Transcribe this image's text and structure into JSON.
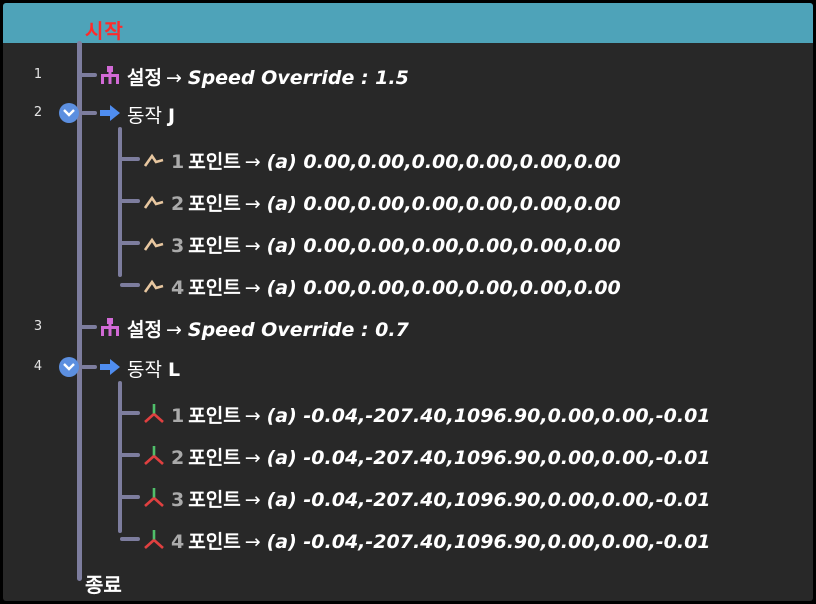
{
  "start_label": "시작",
  "end_label": "종료",
  "rows": [
    {
      "num": "1",
      "title": "설정",
      "detail": "Speed Override : 1.5"
    },
    {
      "num": "2",
      "title": "동작",
      "mode": "J"
    },
    {
      "point_num": "1",
      "point_label": "포인트",
      "value": "(a) 0.00,0.00,0.00,0.00,0.00,0.00"
    },
    {
      "point_num": "2",
      "point_label": "포인트",
      "value": "(a) 0.00,0.00,0.00,0.00,0.00,0.00"
    },
    {
      "point_num": "3",
      "point_label": "포인트",
      "value": "(a) 0.00,0.00,0.00,0.00,0.00,0.00"
    },
    {
      "point_num": "4",
      "point_label": "포인트",
      "value": "(a) 0.00,0.00,0.00,0.00,0.00,0.00"
    },
    {
      "num": "3",
      "title": "설정",
      "detail": "Speed Override : 0.7"
    },
    {
      "num": "4",
      "title": "동작",
      "mode": "L"
    },
    {
      "point_num": "1",
      "point_label": "포인트",
      "value": "(a) -0.04,-207.40,1096.90,0.00,0.00,-0.01"
    },
    {
      "point_num": "2",
      "point_label": "포인트",
      "value": "(a) -0.04,-207.40,1096.90,0.00,0.00,-0.01"
    },
    {
      "point_num": "3",
      "point_label": "포인트",
      "value": "(a) -0.04,-207.40,1096.90,0.00,0.00,-0.01"
    },
    {
      "point_num": "4",
      "point_label": "포인트",
      "value": "(a) -0.04,-207.40,1096.90,0.00,0.00,-0.01"
    }
  ],
  "arrow": "→",
  "colors": {
    "header": "#4ea3b9",
    "start": "#ff2a2a",
    "tree_line": "#7d7d9e",
    "set_icon": "#d26ad6",
    "move_icon": "#4f8df0",
    "joint_point_icon": "#e8c7a0",
    "linear_point_icon": "#e04040"
  }
}
